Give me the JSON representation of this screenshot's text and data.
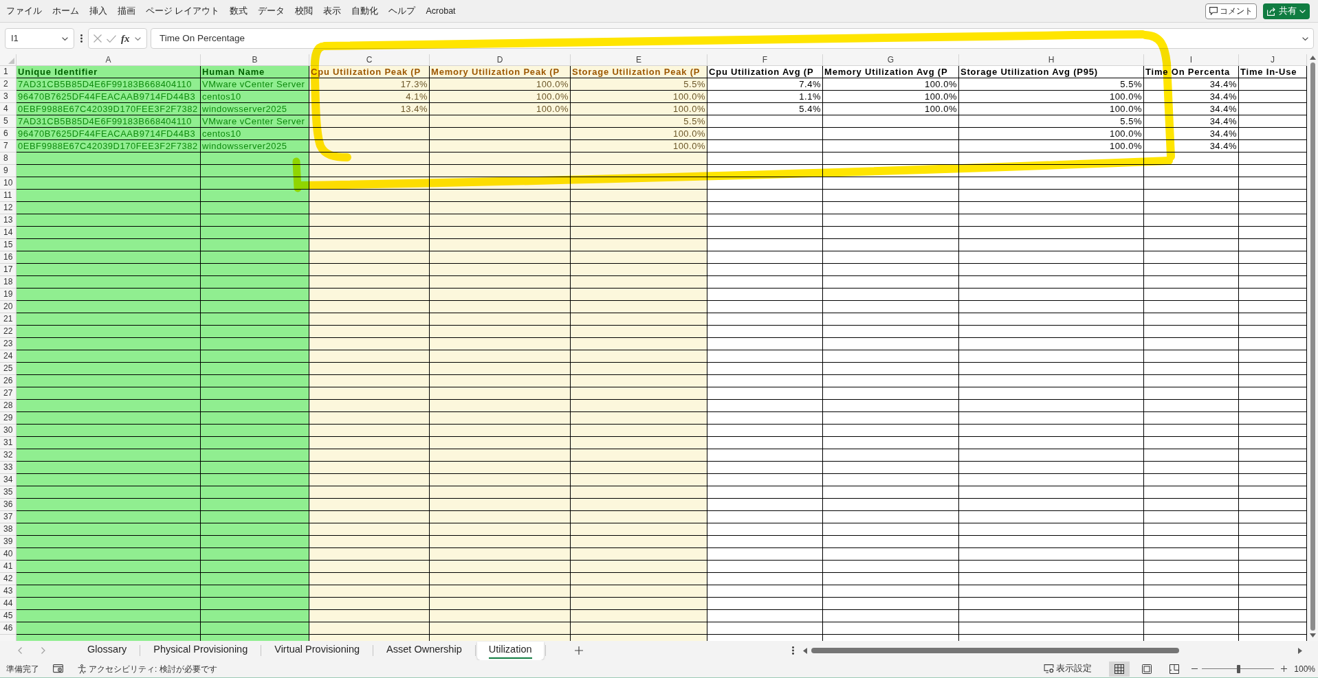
{
  "ribbon_tabs": [
    "ファイル",
    "ホーム",
    "挿入",
    "描画",
    "ページ レイアウト",
    "数式",
    "データ",
    "校閲",
    "表示",
    "自動化",
    "ヘルプ",
    "Acrobat"
  ],
  "comment_button": {
    "label": "コメント"
  },
  "share_button": {
    "label": "共有"
  },
  "formula_bar": {
    "name_box": "I1",
    "function_label": "fx",
    "formula": "Time On Percentage"
  },
  "sheet": {
    "columns": [
      {
        "letter": "A",
        "kind": "identity"
      },
      {
        "letter": "B",
        "kind": "identity"
      },
      {
        "letter": "C",
        "kind": "peak"
      },
      {
        "letter": "D",
        "kind": "peak"
      },
      {
        "letter": "E",
        "kind": "peak"
      },
      {
        "letter": "F",
        "kind": "average"
      },
      {
        "letter": "G",
        "kind": "average"
      },
      {
        "letter": "H",
        "kind": "average"
      },
      {
        "letter": "I",
        "kind": "average"
      },
      {
        "letter": "J",
        "kind": "average"
      }
    ],
    "rows": [
      {
        "number": "1",
        "kind": "header",
        "cells": [
          "Unique Identifier",
          "Human Name",
          "Cpu Utilization Peak (P",
          "Memory Utilization Peak (P",
          "Storage Utilization Peak (P",
          "Cpu Utilization Avg (P",
          "Memory Utilization Avg (P",
          "Storage Utilization Avg (P95)",
          "Time On Percenta",
          "Time In-Use"
        ]
      },
      {
        "number": "2",
        "kind": "data",
        "cells": [
          "7AD31CB5B85D4E6F99183B668404110",
          "VMware vCenter Server",
          "17.3%",
          "100.0%",
          "5.5%",
          "7.4%",
          "100.0%",
          "5.5%",
          "34.4%",
          null
        ]
      },
      {
        "number": "3",
        "kind": "data",
        "cells": [
          "96470B7625DF44FEACAAB9714FD44B3",
          "centos10",
          "4.1%",
          "100.0%",
          "100.0%",
          "1.1%",
          "100.0%",
          "100.0%",
          "34.4%",
          null
        ]
      },
      {
        "number": "4",
        "kind": "data",
        "cells": [
          "0EBF9988E67C42039D170FEE3F2F7382",
          "windowsserver2025",
          "13.4%",
          "100.0%",
          "100.0%",
          "5.4%",
          "100.0%",
          "100.0%",
          "34.4%",
          null
        ]
      },
      {
        "number": "5",
        "kind": "data",
        "cells": [
          "7AD31CB5B85D4E6F99183B668404110",
          "VMware vCenter Server",
          null,
          null,
          "5.5%",
          null,
          null,
          "5.5%",
          "34.4%",
          null
        ]
      },
      {
        "number": "6",
        "kind": "data",
        "cells": [
          "96470B7625DF44FEACAAB9714FD44B3",
          "centos10",
          null,
          null,
          "100.0%",
          null,
          null,
          "100.0%",
          "34.4%",
          null
        ]
      },
      {
        "number": "7",
        "kind": "data",
        "cells": [
          "0EBF9988E67C42039D170FEE3F2F7382",
          "windowsserver2025",
          null,
          null,
          "100.0%",
          null,
          null,
          "100.0%",
          "34.4%",
          null
        ]
      },
      {
        "number": "8"
      },
      {
        "number": "9"
      },
      {
        "number": "10"
      },
      {
        "number": "11"
      },
      {
        "number": "12"
      },
      {
        "number": "13"
      },
      {
        "number": "14"
      },
      {
        "number": "15"
      },
      {
        "number": "16"
      },
      {
        "number": "17"
      },
      {
        "number": "18"
      },
      {
        "number": "19"
      },
      {
        "number": "20"
      },
      {
        "number": "21"
      },
      {
        "number": "22"
      },
      {
        "number": "23"
      },
      {
        "number": "24"
      },
      {
        "number": "25"
      },
      {
        "number": "26"
      },
      {
        "number": "27"
      },
      {
        "number": "28"
      },
      {
        "number": "29"
      },
      {
        "number": "30"
      },
      {
        "number": "31"
      },
      {
        "number": "32"
      },
      {
        "number": "33"
      },
      {
        "number": "34"
      },
      {
        "number": "35"
      },
      {
        "number": "36"
      },
      {
        "number": "37"
      },
      {
        "number": "38"
      },
      {
        "number": "39"
      },
      {
        "number": "40"
      },
      {
        "number": "41"
      },
      {
        "number": "42"
      },
      {
        "number": "43"
      },
      {
        "number": "44"
      },
      {
        "number": "45"
      },
      {
        "number": "46"
      }
    ]
  },
  "sheet_tabs": [
    {
      "label": "Glossary",
      "selected": false
    },
    {
      "label": "Physical Provisioning",
      "selected": false
    },
    {
      "label": "Virtual Provisioning",
      "selected": false
    },
    {
      "label": "Asset Ownership",
      "selected": false
    },
    {
      "label": "Utilization",
      "selected": true
    }
  ],
  "status_bar": {
    "mode": "準備完了",
    "accessibility": "アクセシビリティ: 検討が必要です",
    "display_settings": "表示設定",
    "views": [
      {
        "kind": "normal",
        "selected": true
      },
      {
        "kind": "page-layout",
        "selected": false
      },
      {
        "kind": "page-break",
        "selected": false
      }
    ],
    "zoom": {
      "level": 0.5,
      "value": "100%"
    }
  }
}
